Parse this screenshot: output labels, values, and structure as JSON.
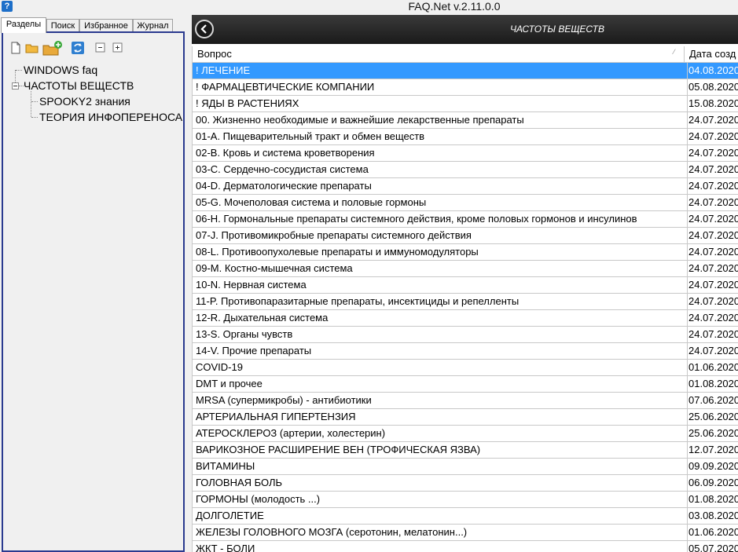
{
  "window": {
    "title": "FAQ.Net v.2.11.0.0",
    "icon": "help-icon"
  },
  "tabs": [
    {
      "label": "Разделы",
      "active": true
    },
    {
      "label": "Поиск",
      "active": false
    },
    {
      "label": "Избранное",
      "active": false
    },
    {
      "label": "Журнал",
      "active": false
    }
  ],
  "toolbar": {
    "icons": [
      "new-file-icon",
      "open-folder-icon",
      "add-folder-icon",
      "refresh-icon",
      "collapse-all-icon",
      "expand-all-icon"
    ]
  },
  "tree": [
    {
      "label": "WINDOWS faq",
      "level": 0
    },
    {
      "label": "ЧАСТОТЫ ВЕЩЕСТВ",
      "level": 0,
      "expanded": true
    },
    {
      "label": "SPOOKY2 знания",
      "level": 1
    },
    {
      "label": "ТЕОРИЯ ИНФОПЕРЕНОСА",
      "level": 1
    }
  ],
  "content": {
    "section_title": "ЧАСТОТЫ ВЕЩЕСТВ",
    "columns": {
      "question": "Вопрос",
      "date": "Дата созд"
    },
    "rows": [
      {
        "q": "! ЛЕЧЕНИЕ",
        "d": "04.08.2020",
        "selected": true
      },
      {
        "q": "! ФАРМАЦЕВТИЧЕСКИЕ КОМПАНИИ",
        "d": "05.08.2020"
      },
      {
        "q": "! ЯДЫ В РАСТЕНИЯХ",
        "d": "15.08.2020"
      },
      {
        "q": "00. Жизненно необходимые и важнейшие лекарственные препараты",
        "d": "24.07.2020"
      },
      {
        "q": "01-A. Пищеварительный тракт и обмен веществ",
        "d": "24.07.2020"
      },
      {
        "q": "02-B. Кровь и система кроветворения",
        "d": "24.07.2020"
      },
      {
        "q": "03-C. Сердечно-сосудистая система",
        "d": "24.07.2020"
      },
      {
        "q": "04-D. Дерматологические препараты",
        "d": "24.07.2020"
      },
      {
        "q": "05-G. Мочеполовая система и половые гормоны",
        "d": "24.07.2020"
      },
      {
        "q": "06-H. Гормональные препараты системного действия, кроме половых гормонов и инсулинов",
        "d": "24.07.2020"
      },
      {
        "q": "07-J. Противомикробные препараты системного действия",
        "d": "24.07.2020"
      },
      {
        "q": "08-L. Противоопухолевые препараты и иммуномодуляторы",
        "d": "24.07.2020"
      },
      {
        "q": "09-M. Костно-мышечная система",
        "d": "24.07.2020"
      },
      {
        "q": "10-N. Нервная система",
        "d": "24.07.2020"
      },
      {
        "q": "11-P. Противопаразитарные препараты, инсектициды и репелленты",
        "d": "24.07.2020"
      },
      {
        "q": "12-R. Дыхательная система",
        "d": "24.07.2020"
      },
      {
        "q": "13-S. Органы чувств",
        "d": "24.07.2020"
      },
      {
        "q": "14-V. Прочие препараты",
        "d": "24.07.2020"
      },
      {
        "q": "COVID-19",
        "d": "01.06.2020"
      },
      {
        "q": "DMT и прочее",
        "d": "01.08.2020"
      },
      {
        "q": "MRSA (супермикробы) - антибиотики",
        "d": "07.06.2020"
      },
      {
        "q": "АРТЕРИАЛЬНАЯ ГИПЕРТЕНЗИЯ",
        "d": "25.06.2020"
      },
      {
        "q": "АТЕРОСКЛЕРОЗ (артерии, холестерин)",
        "d": "25.06.2020"
      },
      {
        "q": "ВАРИКОЗНОЕ РАСШИРЕНИЕ ВЕН (ТРОФИЧЕСКАЯ ЯЗВА)",
        "d": "12.07.2020"
      },
      {
        "q": "ВИТАМИНЫ",
        "d": "09.09.2020"
      },
      {
        "q": "ГОЛОВНАЯ БОЛЬ",
        "d": "06.09.2020"
      },
      {
        "q": "ГОРМОНЫ (молодость ...)",
        "d": "01.08.2020"
      },
      {
        "q": "ДОЛГОЛЕТИЕ",
        "d": "03.08.2020"
      },
      {
        "q": "ЖЕЛЕЗЫ ГОЛОВНОГО МОЗГА (серотонин, мелатонин...)",
        "d": "01.06.2020"
      },
      {
        "q": "ЖКТ - БОЛИ",
        "d": "05.07.2020"
      }
    ]
  },
  "colors": {
    "accent_frame": "#2a3a8f",
    "selection": "#3399ff",
    "header_dark": "#1a1a1a"
  }
}
